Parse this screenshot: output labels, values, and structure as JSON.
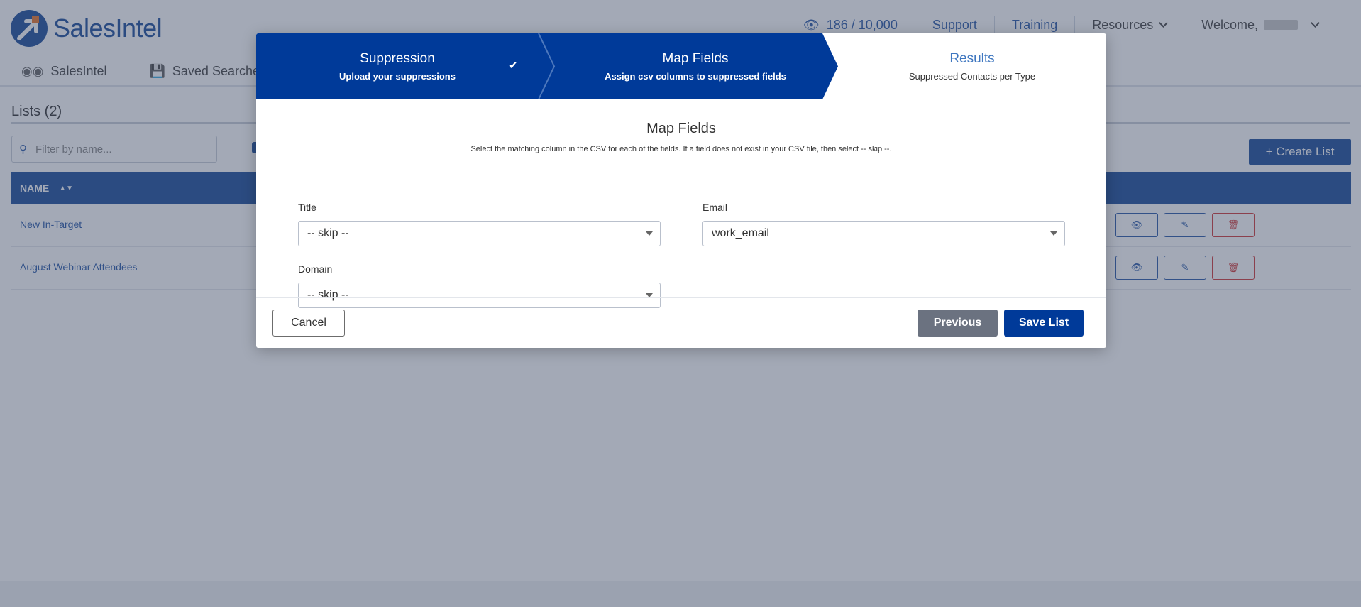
{
  "app": {
    "brand": "SalesIntel",
    "top_nav": {
      "views": "186 / 10,000",
      "support": "Support",
      "training": "Training",
      "resources": "Resources",
      "welcome": "Welcome,"
    },
    "sub_nav": {
      "salesintel": "SalesIntel",
      "saved_searches": "Saved Searches"
    },
    "lists_title": "Lists (2)",
    "filter_placeholder": "Filter by name...",
    "create_list": "+ Create List",
    "table": {
      "header_name": "NAME",
      "rows": [
        {
          "name": "New In-Target"
        },
        {
          "name": "August Webinar Attendees"
        }
      ]
    }
  },
  "modal": {
    "steps": [
      {
        "title": "Suppression",
        "subtitle": "Upload your suppressions",
        "state": "complete"
      },
      {
        "title": "Map Fields",
        "subtitle": "Assign csv columns to suppressed fields",
        "state": "active"
      },
      {
        "title": "Results",
        "subtitle": "Suppressed Contacts per Type",
        "state": "pending"
      }
    ],
    "title": "Map Fields",
    "description": "Select the matching column in the CSV for each of the fields. If a field does not exist in your CSV file, then select -- skip --.",
    "fields": {
      "title": {
        "label": "Title",
        "value": "-- skip --"
      },
      "email": {
        "label": "Email",
        "value": "work_email"
      },
      "domain": {
        "label": "Domain",
        "value": "-- skip --"
      }
    },
    "buttons": {
      "cancel": "Cancel",
      "previous": "Previous",
      "save": "Save List"
    }
  },
  "colors": {
    "brand_blue": "#1e4f9c",
    "step_active": "#003a99",
    "previous_button": "#6b7280",
    "delete_red": "#d23a3a"
  }
}
